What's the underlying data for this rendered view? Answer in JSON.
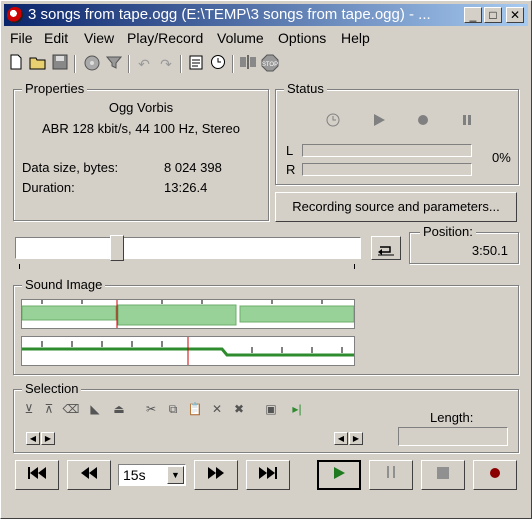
{
  "window": {
    "title": "3 songs from tape.ogg (E:\\TEMP\\3 songs from tape.ogg) - ...",
    "minimize": "_",
    "maximize": "□",
    "close": "✕"
  },
  "menu": [
    "File",
    "Edit",
    "View",
    "Play/Record",
    "Volume",
    "Options",
    "Help"
  ],
  "toolbar": {
    "icons": [
      "new-icon",
      "open-icon",
      "save-icon",
      "cd-icon",
      "filter-icon",
      "undo-icon",
      "redo-icon",
      "properties-icon",
      "clock-icon",
      "split-icon",
      "stop-icon"
    ]
  },
  "properties": {
    "label": "Properties",
    "format": "Ogg Vorbis",
    "details": "ABR 128 kbit/s, 44 100 Hz, Stereo",
    "data_size_label": "Data size, bytes:",
    "data_size_value": "8 024 398",
    "duration_label": "Duration:",
    "duration_value": "13:26.4"
  },
  "status": {
    "label": "Status",
    "left_channel": "L",
    "right_channel": "R",
    "percent": "0%"
  },
  "recording_button": "Recording source and parameters...",
  "position": {
    "label": "Position:",
    "value": "3:50.1",
    "slider_fraction": 0.285
  },
  "sound_image": {
    "label": "Sound Image"
  },
  "selection": {
    "label": "Selection",
    "length_label": "Length:",
    "length_value": ""
  },
  "transport": {
    "skip_value": "15s",
    "icons": [
      "go-to-start",
      "rewind",
      "fast-forward",
      "go-to-end",
      "play",
      "pause",
      "stop",
      "record"
    ]
  },
  "colors": {
    "title_start": "#0a246a",
    "title_end": "#a6caf0",
    "wave_green": "#2e8b2e",
    "record_red": "#8b0000"
  }
}
